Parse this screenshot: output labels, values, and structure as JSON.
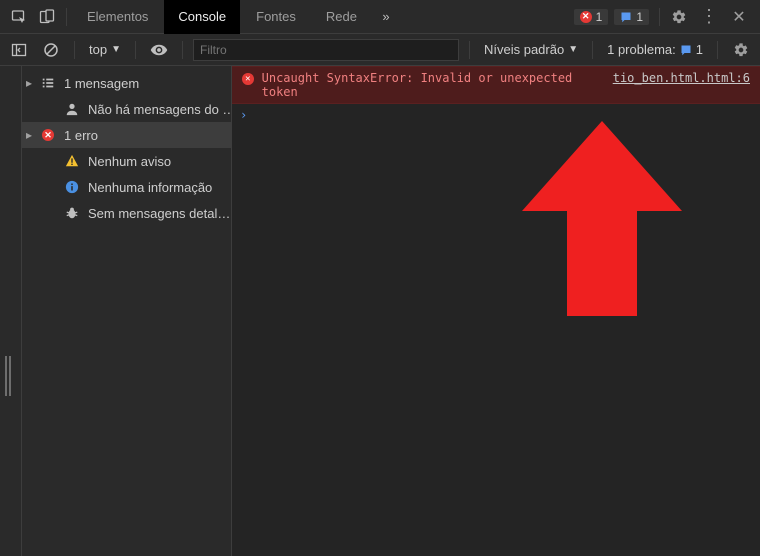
{
  "tabs": {
    "elements": "Elementos",
    "console": "Console",
    "sources": "Fontes",
    "network": "Rede"
  },
  "topbar": {
    "moreTabs": "»",
    "errorBadgeCount": "1",
    "issueBadgeCount": "1",
    "menu": "⋮",
    "close": "✕"
  },
  "subbar": {
    "contextLabel": "top",
    "filterPlaceholder": "Filtro",
    "levelsLabel": "Níveis padrão",
    "problemsLabel": "1 problema:",
    "problemsCount": "1"
  },
  "sidebar": {
    "messages": "1 mensagem",
    "noUserMessages": "Não há mensagens do …",
    "errors": "1 erro",
    "warnings": "Nenhum aviso",
    "info": "Nenhuma informação",
    "debug": "Sem mensagens detal…"
  },
  "error": {
    "message": "Uncaught SyntaxError: Invalid or unexpected token",
    "source": "tio_ben.html.html:6"
  },
  "prompt": "›"
}
